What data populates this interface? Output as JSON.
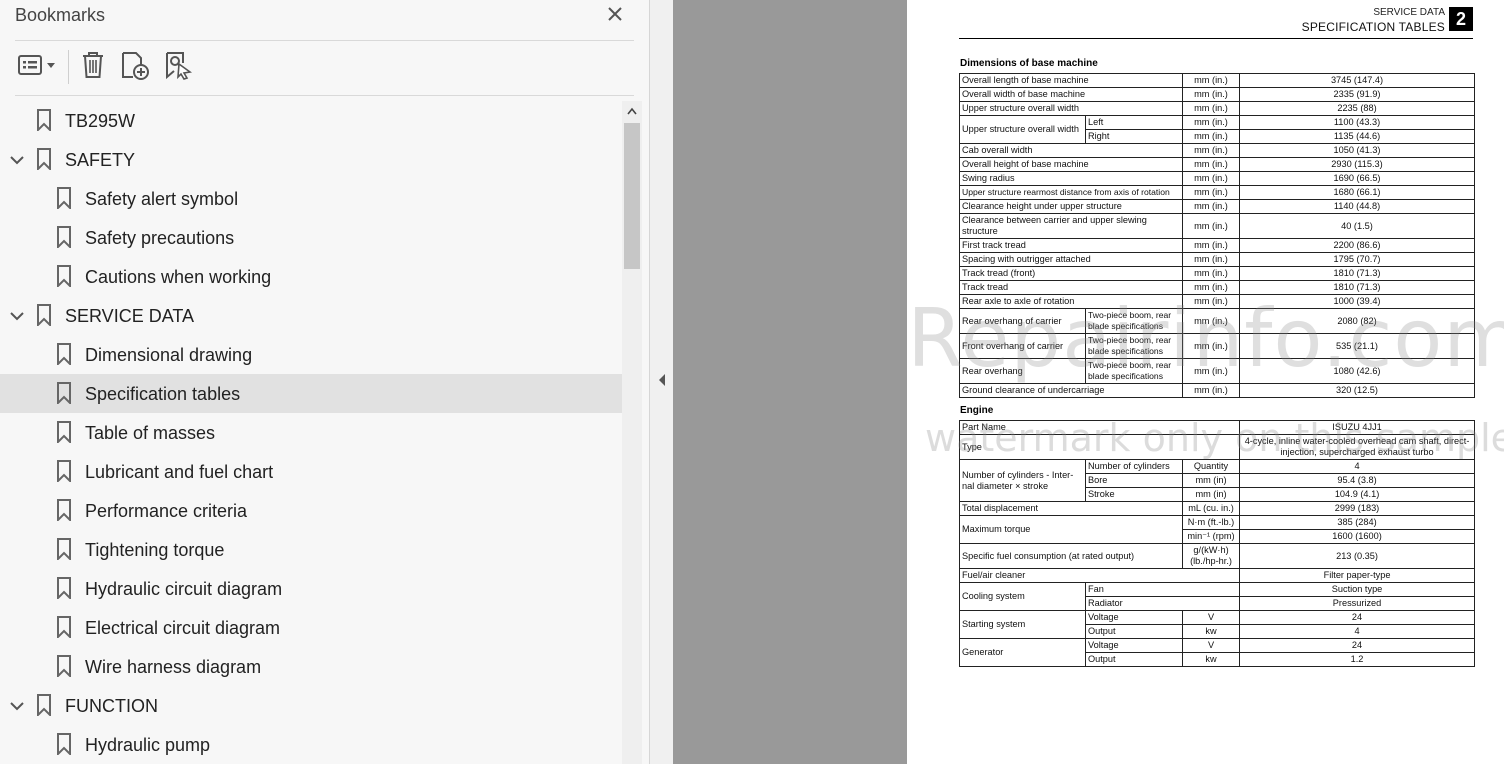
{
  "panel": {
    "title": "Bookmarks",
    "toolbar": {
      "options_icon": "list-options-icon",
      "delete_icon": "trash-icon",
      "new_bookmark_icon": "new-bookmark-icon",
      "find_bookmark_icon": "find-bookmark-icon"
    }
  },
  "bookmarks": [
    {
      "label": "TB295W",
      "level": 0,
      "expandable": false
    },
    {
      "label": "SAFETY",
      "level": 0,
      "expandable": true
    },
    {
      "label": "Safety alert symbol",
      "level": 1
    },
    {
      "label": "Safety precautions",
      "level": 1
    },
    {
      "label": "Cautions when working",
      "level": 1
    },
    {
      "label": "SERVICE DATA",
      "level": 0,
      "expandable": true
    },
    {
      "label": "Dimensional drawing",
      "level": 1
    },
    {
      "label": "Specification tables",
      "level": 1,
      "selected": true
    },
    {
      "label": "Table of masses",
      "level": 1
    },
    {
      "label": "Lubricant and fuel chart",
      "level": 1
    },
    {
      "label": "Performance criteria",
      "level": 1
    },
    {
      "label": "Tightening torque",
      "level": 1
    },
    {
      "label": "Hydraulic circuit diagram",
      "level": 1
    },
    {
      "label": "Electrical circuit diagram",
      "level": 1
    },
    {
      "label": "Wire harness diagram",
      "level": 1
    },
    {
      "label": "FUNCTION",
      "level": 0,
      "expandable": true
    },
    {
      "label": "Hydraulic pump",
      "level": 1
    }
  ],
  "document": {
    "header_section": "SERVICE DATA",
    "header_title": "SPECIFICATION TABLES",
    "chapter_number": "2",
    "dimensions_title": "Dimensions of base machine",
    "engine_title": "Engine",
    "watermark_main": "eRepairinfo.com",
    "watermark_sub": "watermark only on this sample",
    "dim": {
      "r1": [
        "Overall length of base machine",
        "mm (in.)",
        "3745 (147.4)"
      ],
      "r2": [
        "Overall width of base machine",
        "mm (in.)",
        "2335 (91.9)"
      ],
      "r3": [
        "Upper structure overall width",
        "mm (in.)",
        "2235 (88)"
      ],
      "r4": [
        "Upper structure overall width",
        "Left",
        "mm (in.)",
        "1100 (43.3)"
      ],
      "r5": [
        "Right",
        "mm (in.)",
        "1135 (44.6)"
      ],
      "r6": [
        "Cab overall width",
        "mm (in.)",
        "1050 (41.3)"
      ],
      "r7": [
        "Overall height of base machine",
        "mm (in.)",
        "2930 (115.3)"
      ],
      "r8": [
        "Swing radius",
        "mm (in.)",
        "1690 (66.5)"
      ],
      "r9": [
        "Upper structure rearmost distance from axis of rotation",
        "mm (in.)",
        "1680 (66.1)"
      ],
      "r10": [
        "Clearance height under upper structure",
        "mm (in.)",
        "1140 (44.8)"
      ],
      "r11": [
        "Clearance between carrier and upper slewing structure",
        "mm (in.)",
        "40 (1.5)"
      ],
      "r12": [
        "First track tread",
        "mm (in.)",
        "2200 (86.6)"
      ],
      "r13": [
        "Spacing with outrigger attached",
        "mm (in.)",
        "1795 (70.7)"
      ],
      "r14": [
        "Track tread (front)",
        "mm (in.)",
        "1810 (71.3)"
      ],
      "r15": [
        "Track tread",
        "mm (in.)",
        "1810 (71.3)"
      ],
      "r16": [
        "Rear axle to axle of rotation",
        "mm (in.)",
        "1000 (39.4)"
      ],
      "r17": [
        "Rear overhang of carrier",
        "Two-piece boom, rear blade specifications",
        "mm (in.)",
        "2080 (82)"
      ],
      "r18": [
        "Front overhang of carrier",
        "Two-piece boom, rear blade specifications",
        "mm (in.)",
        "535 (21.1)"
      ],
      "r19": [
        "Rear overhang",
        "Two-piece boom, rear blade specifications",
        "mm (in.)",
        "1080 (42.6)"
      ],
      "r20": [
        "Ground clearance of undercarriage",
        "mm (in.)",
        "320 (12.5)"
      ]
    },
    "eng": {
      "r1": [
        "Part Name",
        "ISUZU 4JJ1"
      ],
      "r2": [
        "Type",
        "4-cycle, inline water-cooled overhead cam shaft, direct-injection, supercharged exhaust turbo"
      ],
      "r3": [
        "Number of cylinders - Inter-nal diameter × stroke",
        "Number of cylinders",
        "Quantity",
        "4"
      ],
      "r4": [
        "Bore",
        "mm (in)",
        "95.4 (3.8)"
      ],
      "r5": [
        "Stroke",
        "mm (in)",
        "104.9 (4.1)"
      ],
      "r6": [
        "Total displacement",
        "mL (cu. in.)",
        "2999 (183)"
      ],
      "r7": [
        "Maximum torque",
        "N·m (ft.-lb.)",
        "385 (284)"
      ],
      "r8": [
        "min⁻¹ (rpm)",
        "1600 (1600)"
      ],
      "r9": [
        "Specific fuel consumption (at rated output)",
        "g/(kW·h) (lb./hp-hr.)",
        "213 (0.35)"
      ],
      "r10": [
        "Fuel/air cleaner",
        "Filter paper-type"
      ],
      "r11": [
        "Cooling system",
        "Fan",
        "Suction type"
      ],
      "r12": [
        "Radiator",
        "Pressurized"
      ],
      "r13": [
        "Starting system",
        "Voltage",
        "V",
        "24"
      ],
      "r14": [
        "Output",
        "kw",
        "4"
      ],
      "r15": [
        "Generator",
        "Voltage",
        "V",
        "24"
      ],
      "r16": [
        "Output",
        "kw",
        "1.2"
      ]
    }
  }
}
